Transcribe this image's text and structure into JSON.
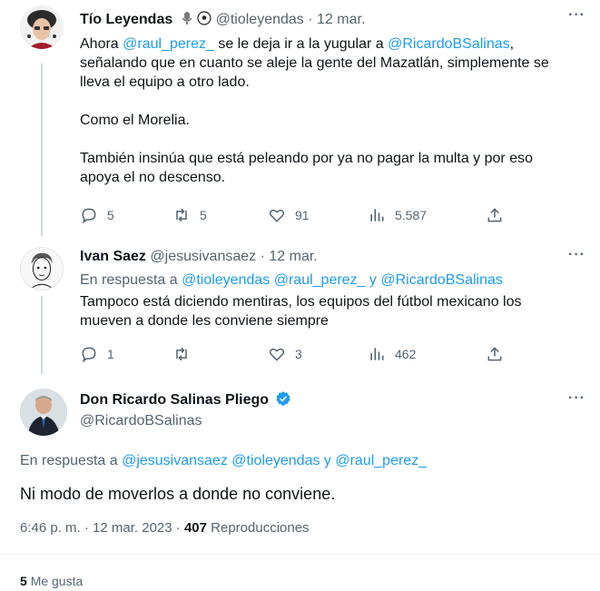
{
  "tweet1": {
    "name": "Tío Leyendas",
    "handle": "@tioleyendas",
    "sep": "·",
    "date": "12 mar.",
    "text_prefix": "Ahora ",
    "mention1": "@raul_perez_",
    "text_mid": " se le deja ir a la yugular a ",
    "mention2": "@RicardoBSalinas",
    "text_end": ",",
    "line2": "señalando que en cuanto se aleje la gente del Mazatlán, simplemente se",
    "line3": "lleva el equipo a otro lado.",
    "para2": "Como el Morelia.",
    "para3_line1": "También insinúa que está peleando por ya no pagar la multa y por eso",
    "para3_line2": "apoya el no descenso.",
    "replies": "5",
    "retweets": "5",
    "likes": "91",
    "views": "5.587"
  },
  "tweet2": {
    "name": "Ivan Saez",
    "handle": "@jesusivansaez",
    "sep": "·",
    "date": "12 mar.",
    "reply_prefix": "En respuesta a ",
    "reply_m1": "@tioleyendas",
    "reply_m2": "@raul_perez_",
    "reply_y": " y ",
    "reply_m3": "@RicardoBSalinas",
    "line1": "Tampoco está diciendo mentiras, los equipos del fútbol mexicano los",
    "line2": "mueven a donde les conviene siempre",
    "replies": "1",
    "retweets": "",
    "likes": "3",
    "views": "462"
  },
  "tweet3": {
    "name": "Don Ricardo Salinas Pliego",
    "handle": "@RicardoBSalinas",
    "reply_prefix": "En respuesta a ",
    "reply_m1": "@jesusivansaez",
    "reply_m2": "@tioleyendas",
    "reply_y": " y ",
    "reply_m3": "@raul_perez_",
    "text": "Ni modo de moverlos a donde no conviene.",
    "time": "6:46 p. m.",
    "sep": "·",
    "date": "12 mar. 2023",
    "views_count": "407",
    "views_label": "Reproducciones",
    "likes_count": "5",
    "likes_label": "Me gusta"
  },
  "colors": {
    "accent": "#1d9bf0",
    "muted": "#536471",
    "text": "#0f1419",
    "verified": "#1d9bf0"
  }
}
